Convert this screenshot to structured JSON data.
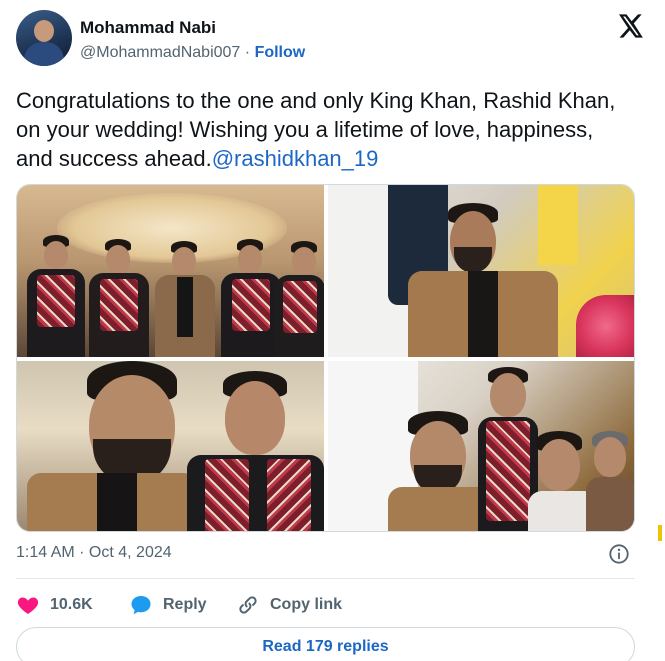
{
  "author": {
    "name": "Mohammad Nabi",
    "handle": "@MohammadNabi007",
    "separator": "·",
    "follow_label": "Follow"
  },
  "tweet": {
    "text": "Congratulations to the one and only King Khan, Rashid Khan, on your wedding! Wishing you a lifetime of love, happiness, and success ahead.",
    "mention": "@rashidkhan_19"
  },
  "media": {
    "photo_count": 4
  },
  "meta": {
    "timestamp": "1:14 AM · Oct 4, 2024"
  },
  "actions": {
    "like_count": "10.6K",
    "reply_label": "Reply",
    "copy_label": "Copy link"
  },
  "read_replies_label": "Read 179 replies",
  "colors": {
    "link": "#1d67c4",
    "like": "#f91880",
    "reply_icon": "#1d9bf0",
    "muted": "#536471"
  },
  "icons": {
    "brand": "x-logo-icon",
    "like": "heart-icon",
    "reply": "speech-bubble-icon",
    "copy": "link-icon",
    "info": "info-icon"
  }
}
